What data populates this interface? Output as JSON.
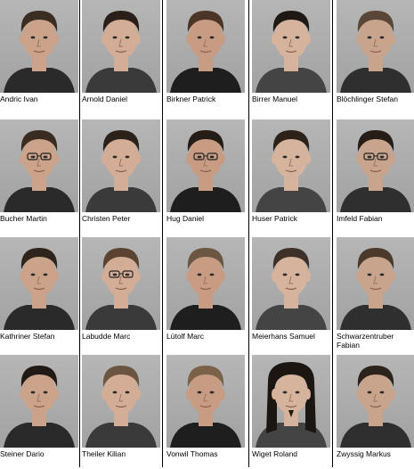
{
  "people": [
    {
      "name": "Andric Ivan",
      "hair": "#3b2d22"
    },
    {
      "name": "Arnold Daniel",
      "hair": "#2a2019"
    },
    {
      "name": "Birkner Patrick",
      "hair": "#4a3526"
    },
    {
      "name": "Birrer Manuel",
      "hair": "#1f1915"
    },
    {
      "name": "Blöchlinger Stefan",
      "hair": "#5a4636"
    },
    {
      "name": "Bucher Martin",
      "hair": "#3a2c20",
      "glasses": true
    },
    {
      "name": "Christen Peter",
      "hair": "#2b2119"
    },
    {
      "name": "Hug Daniel",
      "hair": "#241c16",
      "glasses": true
    },
    {
      "name": "Huser Patrick",
      "hair": "#2c221a"
    },
    {
      "name": "Imfeld Fabian",
      "hair": "#261d16",
      "glasses": true
    },
    {
      "name": "Kathriner Stefan",
      "hair": "#2e241c"
    },
    {
      "name": "Labudde Marc",
      "hair": "#5b4331",
      "glasses": true
    },
    {
      "name": "Lütolf Marc",
      "hair": "#6a5642"
    },
    {
      "name": "Meierhans Samuel",
      "hair": "#3d3028"
    },
    {
      "name": "Schwarzentruber\nFabian",
      "hair": "#4b392b"
    },
    {
      "name": "Steiner Dario",
      "hair": "#221a14"
    },
    {
      "name": "Theiler Kilian",
      "hair": "#6b5540"
    },
    {
      "name": "Vonwil Thomas",
      "hair": "#7a6248"
    },
    {
      "name": "Wiget Roland",
      "hair": "#1c1612",
      "long": true
    },
    {
      "name": "Zwyssig Markus",
      "hair": "#2c231c"
    }
  ]
}
